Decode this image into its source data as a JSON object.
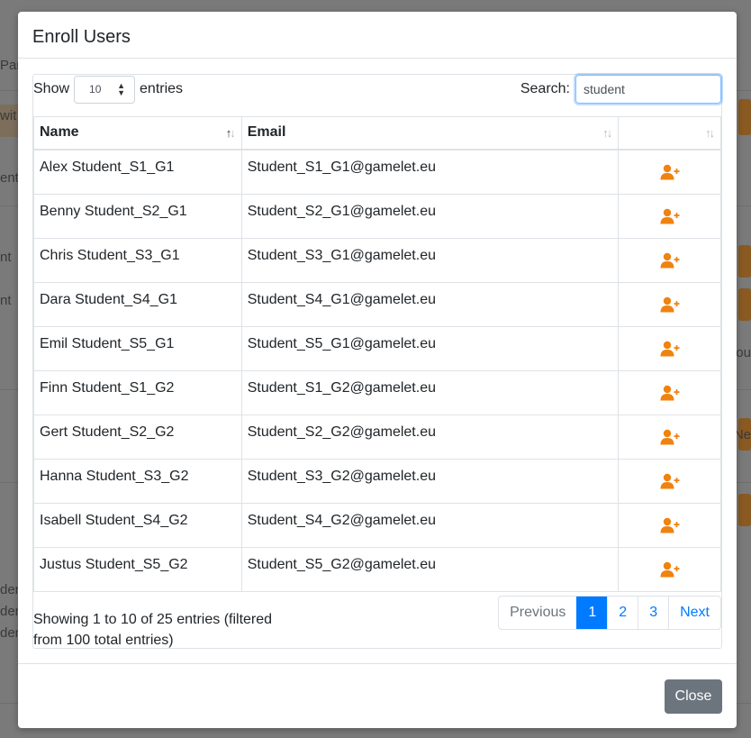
{
  "background": {
    "fragments": [
      "Par",
      "wit",
      "ent",
      "nt",
      "nt",
      "iou",
      "Ne",
      "den",
      "den",
      "den"
    ]
  },
  "modal": {
    "title": "Enroll Users",
    "show_label": "Show",
    "entries_label": "entries",
    "page_length": "10",
    "search_label": "Search:",
    "search_value": "student",
    "columns": [
      "Name",
      "Email",
      ""
    ],
    "rows": [
      {
        "name": "Alex Student_S1_G1",
        "email": "Student_S1_G1@gamelet.eu"
      },
      {
        "name": "Benny Student_S2_G1",
        "email": "Student_S2_G1@gamelet.eu"
      },
      {
        "name": "Chris Student_S3_G1",
        "email": "Student_S3_G1@gamelet.eu"
      },
      {
        "name": "Dara Student_S4_G1",
        "email": "Student_S4_G1@gamelet.eu"
      },
      {
        "name": "Emil Student_S5_G1",
        "email": "Student_S5_G1@gamelet.eu"
      },
      {
        "name": "Finn Student_S1_G2",
        "email": "Student_S1_G2@gamelet.eu"
      },
      {
        "name": "Gert Student_S2_G2",
        "email": "Student_S2_G2@gamelet.eu"
      },
      {
        "name": "Hanna Student_S3_G2",
        "email": "Student_S3_G2@gamelet.eu"
      },
      {
        "name": "Isabell Student_S4_G2",
        "email": "Student_S4_G2@gamelet.eu"
      },
      {
        "name": "Justus Student_S5_G2",
        "email": "Student_S5_G2@gamelet.eu"
      }
    ],
    "row_action_icon": "user-plus-icon",
    "info": "Showing 1 to 10 of 25 entries (filtered from 100 total entries)",
    "pagination": {
      "previous": "Previous",
      "pages": [
        "1",
        "2",
        "3"
      ],
      "active_page": "1",
      "next": "Next"
    },
    "close_label": "Close"
  },
  "colors": {
    "accent": "#007bff",
    "action_icon": "#f0820f",
    "close_button": "#6c757d"
  }
}
